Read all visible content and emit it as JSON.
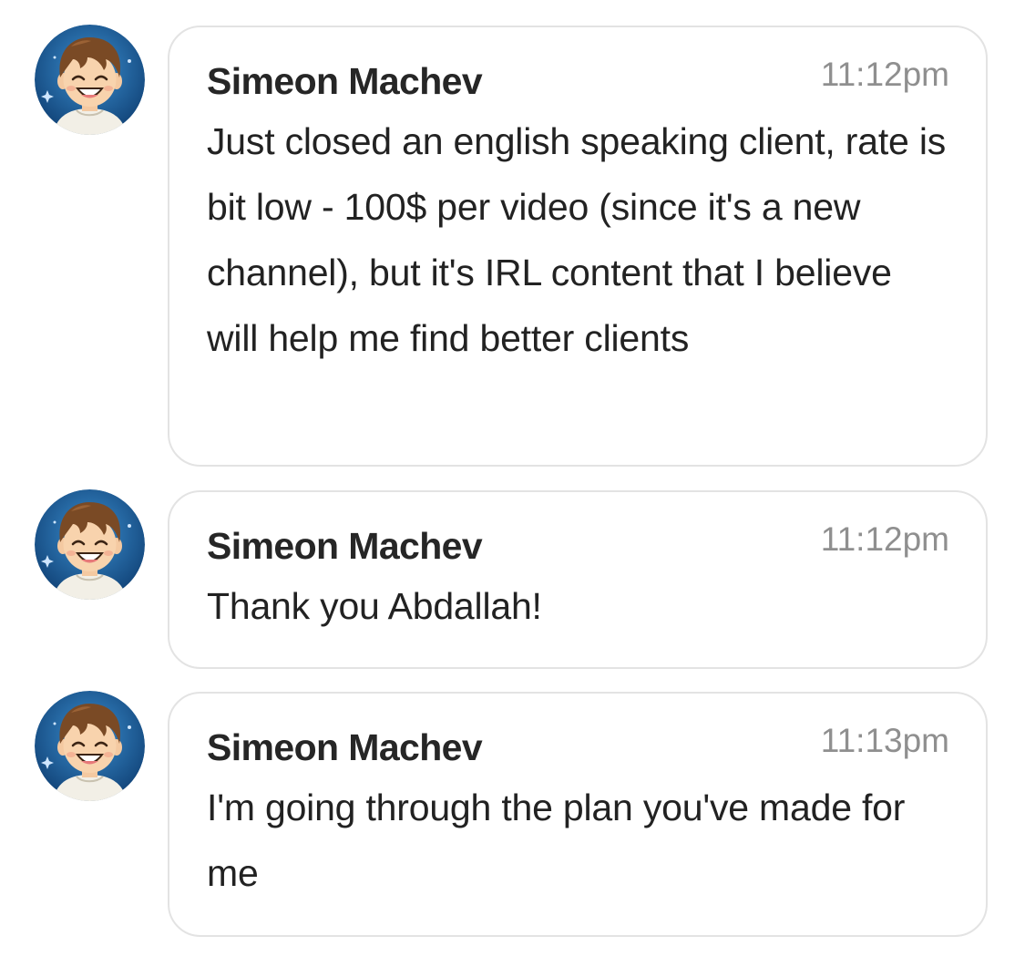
{
  "messages": [
    {
      "sender": "Simeon Machev",
      "time": "11:12pm",
      "text": "Just closed an english speaking client, rate is bit low - 100$ per video (since it's a new channel), but it's IRL content that I believe will help me find better clients",
      "avatar": "cartoon-boy-avatar"
    },
    {
      "sender": "Simeon Machev",
      "time": "11:12pm",
      "text": "Thank you Abdallah!",
      "avatar": "cartoon-boy-avatar"
    },
    {
      "sender": "Simeon Machev",
      "time": "11:13pm",
      "text": "I'm going through the plan you've made for me",
      "avatar": "cartoon-boy-avatar"
    }
  ],
  "colors": {
    "bubble_border": "#e3e3e3",
    "timestamp": "#8f8f8f",
    "avatar_bg": "#1a5a94"
  }
}
